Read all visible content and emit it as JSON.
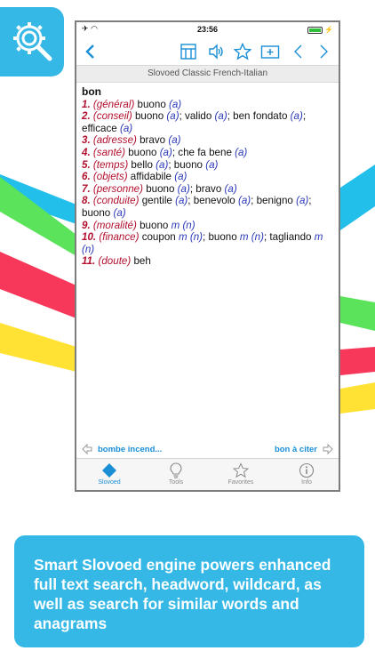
{
  "status": {
    "time": "23:56"
  },
  "dictionary_title": "Slovoed Classic French-Italian",
  "entry": {
    "headword": "bon",
    "senses": [
      {
        "num": "1.",
        "label": "(général)",
        "parts": [
          {
            "t": " buono "
          },
          {
            "g": "(a)"
          }
        ]
      },
      {
        "num": "2.",
        "label": "(conseil)",
        "parts": [
          {
            "t": " buono "
          },
          {
            "g": "(a)"
          },
          {
            "t": "; valido "
          },
          {
            "g": "(a)"
          },
          {
            "t": "; ben fondato "
          },
          {
            "g": "(a)"
          },
          {
            "t": "; efficace "
          },
          {
            "g": "(a)"
          }
        ]
      },
      {
        "num": "3.",
        "label": "(adresse)",
        "parts": [
          {
            "t": " bravo "
          },
          {
            "g": "(a)"
          }
        ]
      },
      {
        "num": "4.",
        "label": "(santé)",
        "parts": [
          {
            "t": " buono "
          },
          {
            "g": "(a)"
          },
          {
            "t": "; che fa bene "
          },
          {
            "g": "(a)"
          }
        ]
      },
      {
        "num": "5.",
        "label": "(temps)",
        "parts": [
          {
            "t": " bello "
          },
          {
            "g": "(a)"
          },
          {
            "t": "; buono "
          },
          {
            "g": "(a)"
          }
        ]
      },
      {
        "num": "6.",
        "label": "(objets)",
        "parts": [
          {
            "t": " affidabile "
          },
          {
            "g": "(a)"
          }
        ]
      },
      {
        "num": "7.",
        "label": "(personne)",
        "parts": [
          {
            "t": " buono "
          },
          {
            "g": "(a)"
          },
          {
            "t": "; bravo "
          },
          {
            "g": "(a)"
          }
        ]
      },
      {
        "num": "8.",
        "label": "(conduite)",
        "parts": [
          {
            "t": " gentile "
          },
          {
            "g": "(a)"
          },
          {
            "t": "; benevolo "
          },
          {
            "g": "(a)"
          },
          {
            "t": "; benigno "
          },
          {
            "g": "(a)"
          },
          {
            "t": "; buono "
          },
          {
            "g": "(a)"
          }
        ]
      },
      {
        "num": "9.",
        "label": "(moralité)",
        "parts": [
          {
            "t": " buono "
          },
          {
            "g": "m (n)"
          }
        ]
      },
      {
        "num": "10.",
        "label": "(finance)",
        "parts": [
          {
            "t": " coupon "
          },
          {
            "g": "m (n)"
          },
          {
            "t": "; buono "
          },
          {
            "g": "m (n)"
          },
          {
            "t": "; tagliando "
          },
          {
            "g": "m (n)"
          }
        ]
      },
      {
        "num": "11.",
        "label": "(doute)",
        "parts": [
          {
            "t": " beh"
          }
        ]
      }
    ]
  },
  "nav": {
    "prev": "bombe incend...",
    "next": "bon à citer"
  },
  "tabs": [
    {
      "label": "Slovoed",
      "icon": "slovoed-icon",
      "active": true
    },
    {
      "label": "Tools",
      "icon": "lightbulb-icon",
      "active": false
    },
    {
      "label": "Favorites",
      "icon": "star-icon",
      "active": false
    },
    {
      "label": "Info",
      "icon": "info-icon",
      "active": false
    }
  ],
  "caption": "Smart Slovoed engine powers enhanced full text search, headword, wildcard, as well as search for similar words and anagrams",
  "colors": {
    "accent": "#35b8e6",
    "ios_blue": "#1a8fd6",
    "sense_red": "#b2102e",
    "grammar_blue": "#2b39b8"
  }
}
